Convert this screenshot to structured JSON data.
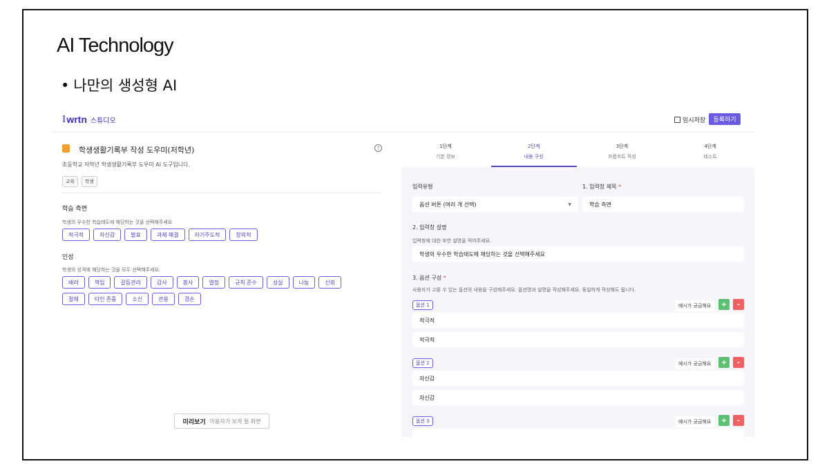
{
  "slide": {
    "title": "AI Technology",
    "bullet": "나만의 생성형 AI"
  },
  "app": {
    "logo_word": "wrtn",
    "logo_sub": "스튜디오",
    "save_draft": "임시저장",
    "register": "등록하기"
  },
  "left": {
    "title": "학생생활기록부 작성 도우미(저학년)",
    "description": "초등학교 저학년 학생생활기록부 도우미 AI 도구입니다.",
    "tags": [
      "교육",
      "학생"
    ],
    "sections": [
      {
        "title": "학습 측면",
        "hint": "학생의 우수한 학습태도에 해당하는 것을 선택해주세요",
        "rows": [
          [
            "적극적",
            "자신감",
            "발표",
            "과제 해결",
            "자기주도적",
            "창의적"
          ]
        ]
      },
      {
        "title": "인성",
        "hint": "학생의 성격에 해당하는 것을 모두 선택해주세요.",
        "rows": [
          [
            "배려",
            "책임",
            "갈등관리",
            "감사",
            "봉사",
            "열정",
            "규칙 준수",
            "성실",
            "나눔",
            "신뢰"
          ],
          [
            "절제",
            "타인 존중",
            "소신",
            "관용",
            "겸손"
          ]
        ]
      }
    ],
    "preview_label": "미리보기",
    "preview_sub": "이용자가 보게 될 화면"
  },
  "steps": [
    {
      "num": "1단계",
      "label": "기본 정보"
    },
    {
      "num": "2단계",
      "label": "내용 구성"
    },
    {
      "num": "3단계",
      "label": "프롬프트 작성"
    },
    {
      "num": "4단계",
      "label": "테스트"
    }
  ],
  "active_step": 1,
  "form": {
    "input_type_label": "입력유형",
    "input_type_value": "옵션 버튼 (여러 개 선택)",
    "title_label": "1. 입력창 제목",
    "title_value": "학습 측면",
    "desc_label": "2. 입력창 설명",
    "desc_hint": "입력창에 대한 부연 설명을 적어주세요.",
    "desc_value": "학생의 우수한 학습태도에 해당하는 것을 선택해주세요",
    "options_label": "3. 옵션 구성",
    "options_hint": "사용자가 고를 수 있는 옵션의 내용을 구성해주세요. 옵션명과 설명을 작성해주세요. 동일하게 작성해도 됩니다.",
    "example_btn": "예시가 궁금해요",
    "options": [
      {
        "badge": "옵션 1",
        "name": "적극적",
        "desc": "적극적"
      },
      {
        "badge": "옵션 2",
        "name": "자신감",
        "desc": "자신감"
      },
      {
        "badge": "옵션 3",
        "name": "",
        "desc": ""
      }
    ]
  },
  "colors": {
    "accent": "#6a5ae0",
    "plus": "#5cc070",
    "minus": "#f06060"
  }
}
